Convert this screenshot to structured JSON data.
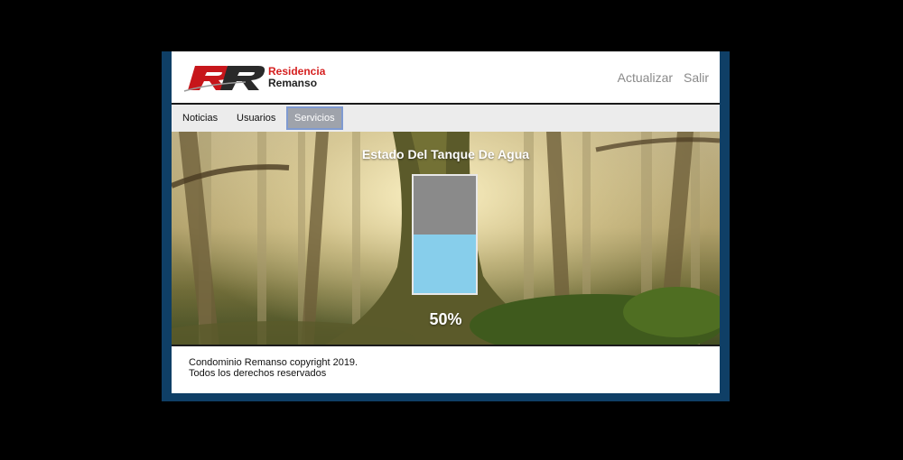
{
  "brand": {
    "line1": "Residencia",
    "line2": "Remanso",
    "accent_color": "#d51f1f"
  },
  "header": {
    "refresh_label": "Actualizar",
    "logout_label": "Salir"
  },
  "nav": {
    "tabs": [
      {
        "label": "Noticias"
      },
      {
        "label": "Usuarios"
      },
      {
        "label": "Servicios",
        "active": true
      }
    ]
  },
  "tank": {
    "title": "Estado Del Tanque De Agua",
    "level_fraction": 0.5,
    "level_label": "50%",
    "water_color": "#87ceeb",
    "empty_color": "#8a8a8a"
  },
  "footer": {
    "line1": "Condominio Remanso copyright 2019.",
    "line2": "Todos los derechos reservados"
  }
}
